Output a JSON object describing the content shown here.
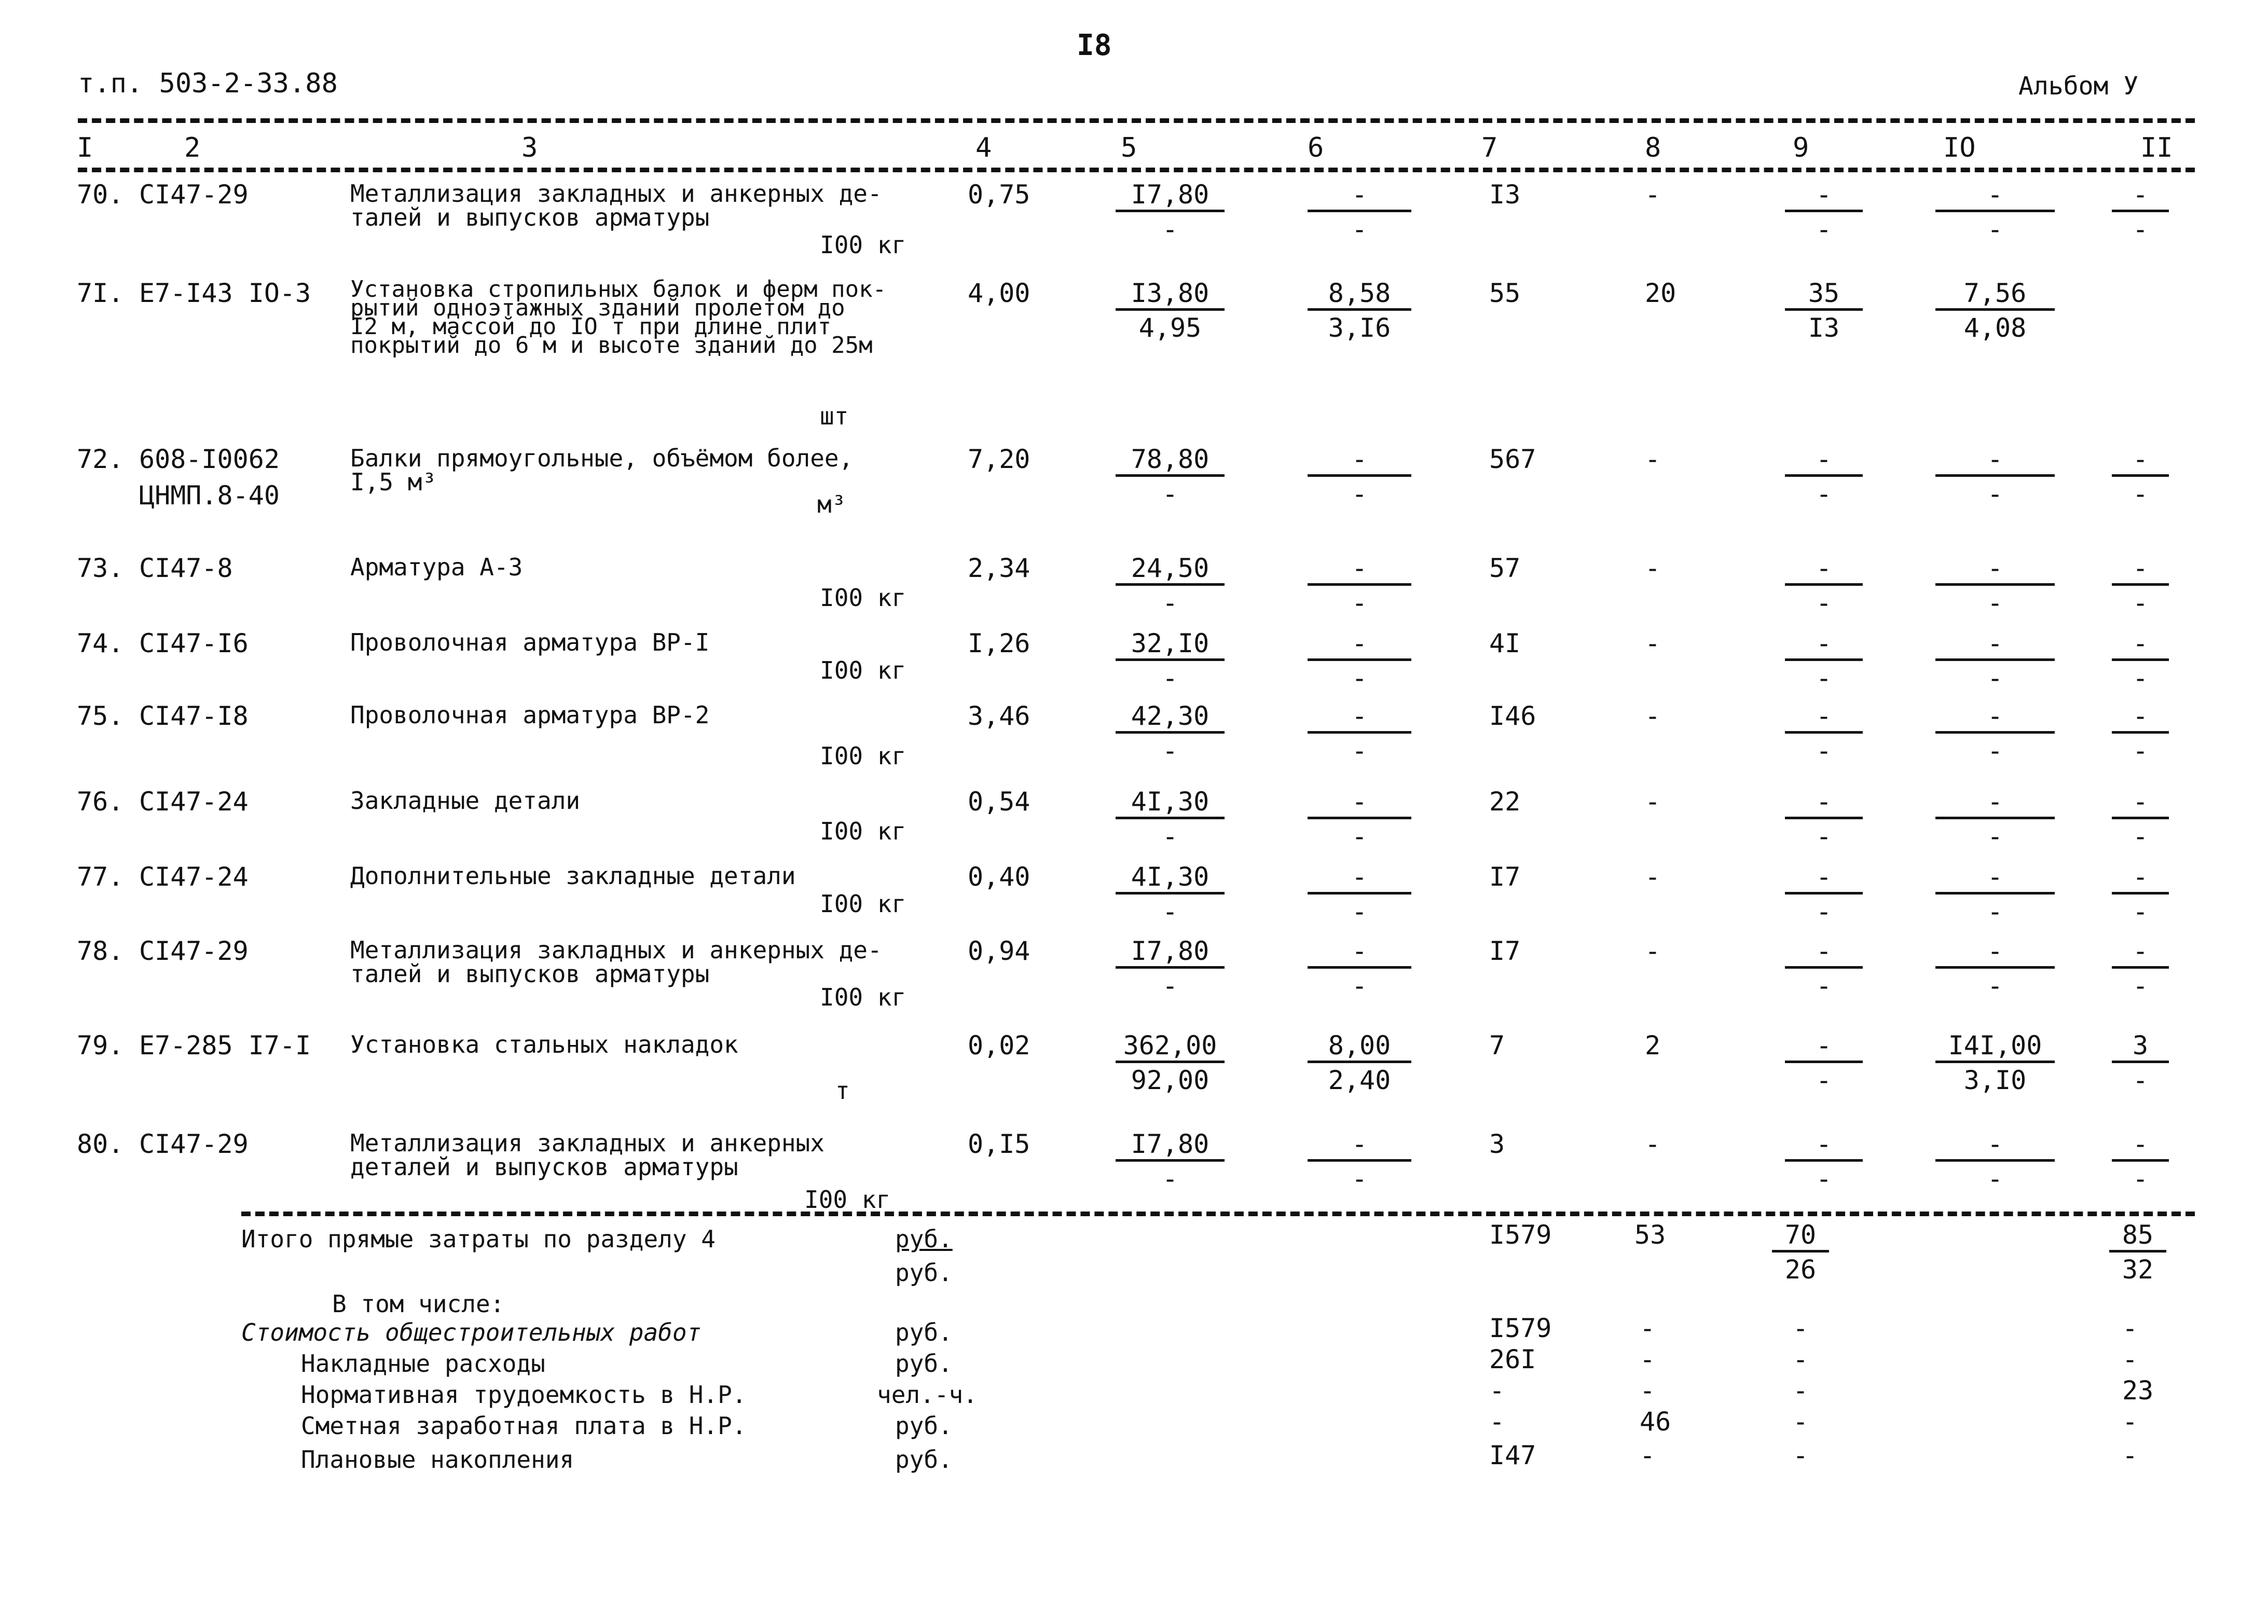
{
  "page": {
    "doc_ref": "т.п. 503-2-33.88",
    "page_number": "I8",
    "album": "Альбом У"
  },
  "header_columns": [
    "I",
    "2",
    "3",
    "4",
    "5",
    "6",
    "7",
    "8",
    "9",
    "IO",
    "II"
  ],
  "rows": [
    {
      "num": "70.",
      "code": "CI47-29",
      "code2": "",
      "desc": "Металлизация закладных и анкерных де-\nталей и выпусков арматуры",
      "unit": "I00 кг",
      "c4": "0,75",
      "c5_top": "I7,80",
      "c5_bot": "-",
      "c6_top": "-",
      "c6_bot": "-",
      "c7": "I3",
      "c8": "-",
      "c9_top": "-",
      "c9_bot": "-",
      "c10_top": "-",
      "c10_bot": "-",
      "c11_top": "-",
      "c11_bot": "-"
    },
    {
      "num": "7I.",
      "code": "E7-I43 IO-3",
      "code2": "",
      "desc": "Установка стропильных балок и ферм пок-\nрытий одноэтажных зданий пролетом до\nI2 м, массой до IO т при длине плит\nпокрытий до 6 м и высоте зданий до 25м",
      "unit": "шт",
      "c4": "4,00",
      "c5_top": "I3,80",
      "c5_bot": "4,95",
      "c6_top": "8,58",
      "c6_bot": "3,I6",
      "c7": "55",
      "c8": "20",
      "c9_top": "35",
      "c9_bot": "I3",
      "c10_top": "7,56",
      "c10_bot": "4,08",
      "c11_top": "",
      "c11_bot": ""
    },
    {
      "num": "72.",
      "code": "608-I0062",
      "code2": "ЦНМП.8-40",
      "desc": "Балки прямоугольные, объёмом более,\nI,5 м³",
      "unit": "м³",
      "c4": "7,20",
      "c5_top": "78,80",
      "c5_bot": "-",
      "c6_top": "-",
      "c6_bot": "-",
      "c7": "567",
      "c8": "-",
      "c9_top": "-",
      "c9_bot": "-",
      "c10_top": "-",
      "c10_bot": "-",
      "c11_top": "-",
      "c11_bot": "-"
    },
    {
      "num": "73.",
      "code": "CI47-8",
      "code2": "",
      "desc": "Арматура А-3",
      "unit": "I00 кг",
      "c4": "2,34",
      "c5_top": "24,50",
      "c5_bot": "-",
      "c6_top": "-",
      "c6_bot": "-",
      "c7": "57",
      "c8": "-",
      "c9_top": "-",
      "c9_bot": "-",
      "c10_top": "-",
      "c10_bot": "-",
      "c11_top": "-",
      "c11_bot": "-"
    },
    {
      "num": "74.",
      "code": "CI47-I6",
      "code2": "",
      "desc": "Проволочная арматура ВР-I",
      "unit": "I00 кг",
      "c4": "I,26",
      "c5_top": "32,I0",
      "c5_bot": "-",
      "c6_top": "-",
      "c6_bot": "-",
      "c7": "4I",
      "c8": "-",
      "c9_top": "-",
      "c9_bot": "-",
      "c10_top": "-",
      "c10_bot": "-",
      "c11_top": "-",
      "c11_bot": "-"
    },
    {
      "num": "75.",
      "code": "CI47-I8",
      "code2": "",
      "desc": "Проволочная арматура ВР-2",
      "unit": "I00 кг",
      "c4": "3,46",
      "c5_top": "42,30",
      "c5_bot": "-",
      "c6_top": "-",
      "c6_bot": "-",
      "c7": "I46",
      "c8": "-",
      "c9_top": "-",
      "c9_bot": "-",
      "c10_top": "-",
      "c10_bot": "-",
      "c11_top": "-",
      "c11_bot": "-"
    },
    {
      "num": "76.",
      "code": "CI47-24",
      "code2": "",
      "desc": "Закладные детали",
      "unit": "I00 кг",
      "c4": "0,54",
      "c5_top": "4I,30",
      "c5_bot": "-",
      "c6_top": "-",
      "c6_bot": "-",
      "c7": "22",
      "c8": "-",
      "c9_top": "-",
      "c9_bot": "-",
      "c10_top": "-",
      "c10_bot": "-",
      "c11_top": "-",
      "c11_bot": "-"
    },
    {
      "num": "77.",
      "code": "CI47-24",
      "code2": "",
      "desc": "Дополнительные закладные детали",
      "unit": "I00 кг",
      "c4": "0,40",
      "c5_top": "4I,30",
      "c5_bot": "-",
      "c6_top": "-",
      "c6_bot": "-",
      "c7": "I7",
      "c8": "-",
      "c9_top": "-",
      "c9_bot": "-",
      "c10_top": "-",
      "c10_bot": "-",
      "c11_top": "-",
      "c11_bot": "-"
    },
    {
      "num": "78.",
      "code": "CI47-29",
      "code2": "",
      "desc": "Металлизация закладных и анкерных де-\nталей и выпусков арматуры",
      "unit": "I00 кг",
      "c4": "0,94",
      "c5_top": "I7,80",
      "c5_bot": "-",
      "c6_top": "-",
      "c6_bot": "-",
      "c7": "I7",
      "c8": "-",
      "c9_top": "-",
      "c9_bot": "-",
      "c10_top": "-",
      "c10_bot": "-",
      "c11_top": "-",
      "c11_bot": "-"
    },
    {
      "num": "79.",
      "code": "E7-285 I7-I",
      "code2": "",
      "desc": "Установка стальных накладок",
      "unit": "т",
      "c4": "0,02",
      "c5_top": "362,00",
      "c5_bot": "92,00",
      "c6_top": "8,00",
      "c6_bot": "2,40",
      "c7": "7",
      "c8": "2",
      "c9_top": "-",
      "c9_bot": "-",
      "c10_top": "I4I,00",
      "c10_bot": "3,I0",
      "c11_top": "3",
      "c11_bot": "-"
    },
    {
      "num": "80.",
      "code": "CI47-29",
      "code2": "",
      "desc": "Металлизация закладных и анкерных\nдеталей и выпусков арматуры",
      "unit": "I00 кг",
      "c4": "0,I5",
      "c5_top": "I7,80",
      "c5_bot": "-",
      "c6_top": "-",
      "c6_bot": "-",
      "c7": "3",
      "c8": "-",
      "c9_top": "-",
      "c9_bot": "-",
      "c10_top": "-",
      "c10_bot": "-",
      "c11_top": "-",
      "c11_bot": "-"
    }
  ],
  "totals": {
    "direct": {
      "label": "Итого прямые затраты по разделу 4",
      "unit1": "руб.",
      "unit2": "руб.",
      "c7": "I579",
      "c8": "53",
      "c9_top": "70",
      "c9_bot": "26",
      "c11_top": "85",
      "c11_bot": "32"
    },
    "including_label": "В том числе:",
    "lines": [
      {
        "label": "Стоимость общестроительных работ",
        "unit": "руб.",
        "c7": "I579",
        "c8": "-",
        "c9": "-",
        "c11": "-"
      },
      {
        "label": "Накладные расходы",
        "unit": "руб.",
        "c7": "26I",
        "c8": "-",
        "c9": "-",
        "c11": "-"
      },
      {
        "label": "Нормативная трудоемкость в Н.Р.",
        "unit": "чел.-ч.",
        "c7": "-",
        "c8": "-",
        "c9": "-",
        "c11": "23"
      },
      {
        "label": "Сметная заработная плата в Н.Р.",
        "unit": "руб.",
        "c7": "-",
        "c8": "46",
        "c9": "-",
        "c11": "-"
      },
      {
        "label": "Плановые накопления",
        "unit": "руб.",
        "c7": "I47",
        "c8": "-",
        "c9": "-",
        "c11": "-"
      }
    ]
  }
}
